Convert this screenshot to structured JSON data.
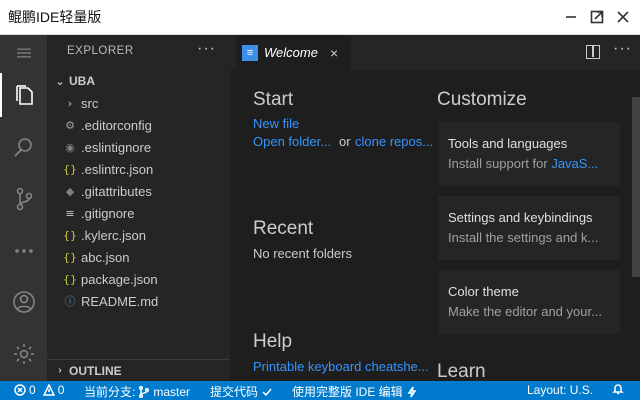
{
  "window": {
    "title": "鲲鹏IDE轻量版"
  },
  "activity_bar": {
    "items": [
      "files-icon",
      "search-icon",
      "source-control-icon",
      "more-icon",
      "account-icon",
      "gear-icon"
    ]
  },
  "explorer": {
    "header": "EXPLORER",
    "more": "···",
    "folder": "UBA",
    "items": [
      {
        "icon": "›",
        "name": "src"
      },
      {
        "icon": "⚙",
        "name": ".editorconfig"
      },
      {
        "icon": "◉",
        "name": ".eslintignore"
      },
      {
        "icon": "{}",
        "name": ".eslintrc.json"
      },
      {
        "icon": "◆",
        "name": ".gitattributes"
      },
      {
        "icon": "≡",
        "name": ".gitignore"
      },
      {
        "icon": "{}",
        "name": ".kylerc.json"
      },
      {
        "icon": "{}",
        "name": "abc.json"
      },
      {
        "icon": "{}",
        "name": "package.json"
      },
      {
        "icon": "ⓘ",
        "name": "README.md"
      }
    ],
    "outline": "OUTLINE"
  },
  "editor": {
    "tab_label": "Welcome",
    "tab_close": "×",
    "more": "···",
    "start": {
      "heading": "Start",
      "new_file": "New file",
      "open_folder": "Open folder...",
      "or": "or",
      "clone_repo": "clone repos..."
    },
    "recent": {
      "heading": "Recent",
      "empty": "No recent folders"
    },
    "help": {
      "heading": "Help",
      "cheatsheet": "Printable keyboard cheatshe..."
    },
    "customize": {
      "heading": "Customize",
      "cards": [
        {
          "title": "Tools and languages",
          "desc_prefix": "Install support for ",
          "desc_link": "JavaS..."
        },
        {
          "title": "Settings and keybindings",
          "desc_prefix": "Install the settings and k...",
          "desc_link": ""
        },
        {
          "title": "Color theme",
          "desc_prefix": "Make the editor and your...",
          "desc_link": ""
        }
      ]
    },
    "learn": {
      "heading": "Learn"
    }
  },
  "status_bar": {
    "errors": "0",
    "warnings": "0",
    "branch_label": "当前分支:",
    "branch": "master",
    "commit": "提交代码",
    "full_ide": "使用完整版 IDE 编辑",
    "layout": "Layout: U.S."
  }
}
